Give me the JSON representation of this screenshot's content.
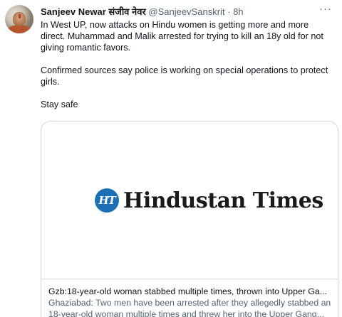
{
  "tweet": {
    "author_name": "Sanjeev Newar संजीव नेवर",
    "author_handle": "@SanjeevSanskrit",
    "separator": "·",
    "time": "8h",
    "more_label": "···",
    "paragraphs": [
      "In West UP, now attacks on Hindu women is getting more and more direct. Muhammad and Malik arrested for trying to kill an 18y old for not giving romantic favors.",
      "Confirmed sources say police is working on special operations to protect girls.",
      "Stay safe"
    ]
  },
  "card": {
    "logo_badge": "HT",
    "logo_text": "Hindustan Times",
    "title": "Gzb:18-year-old woman stabbed multiple times, thrown into Upper Ga...",
    "description_lines": [
      "Ghaziabad: Two men have been arrested after they allegedly stabbed an",
      "18-year-old woman multiple times and threw her into the Upper Gang..."
    ]
  },
  "colors": {
    "text_primary": "#0f1419",
    "text_secondary": "#536471",
    "border": "#cfd9de",
    "ht_badge": "#1c6fb5"
  }
}
